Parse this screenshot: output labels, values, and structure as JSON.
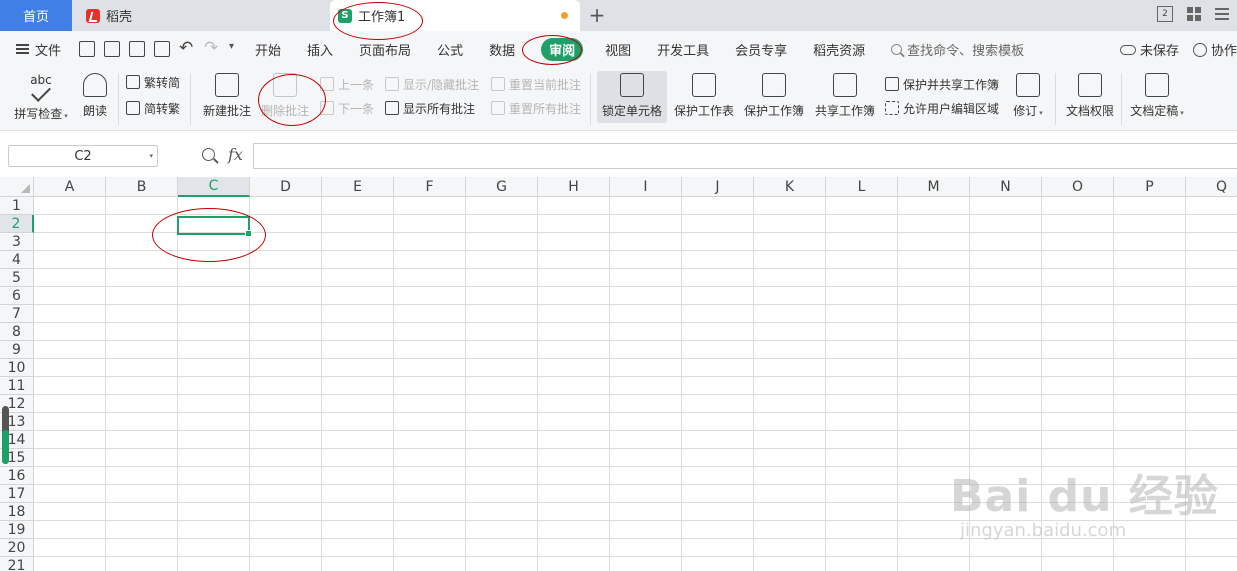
{
  "tabs": {
    "home": "首页",
    "daoke": "稻壳",
    "workbook": "工作簿1",
    "add": "+"
  },
  "window": {
    "layout_badge": "2"
  },
  "menu": {
    "file": "文件",
    "items": [
      "开始",
      "插入",
      "页面布局",
      "公式",
      "数据",
      "审阅",
      "视图",
      "开发工具",
      "会员专享",
      "稻壳资源"
    ],
    "active": "审阅",
    "search": "查找命令、搜索模板",
    "unsaved": "未保存",
    "collab": "协作"
  },
  "ribbon": {
    "abc": "abc",
    "spell_check": "拼写检查",
    "read_aloud": "朗读",
    "trad_to_simp": "繁转简",
    "simp_to_trad": "简转繁",
    "new_comment": "新建批注",
    "delete_comment": "删除批注",
    "prev": "上一条",
    "next": "下一条",
    "show_hide_comment": "显示/隐藏批注",
    "show_all_comments": "显示所有批注",
    "reset_current_comment": "重置当前批注",
    "reset_all_comments": "重置所有批注",
    "lock_cell": "锁定单元格",
    "protect_sheet": "保护工作表",
    "protect_workbook": "保护工作簿",
    "share_workbook": "共享工作簿",
    "protect_share_workbook": "保护并共享工作簿",
    "allow_edit_ranges": "允许用户编辑区域",
    "track_changes": "修订",
    "doc_permission": "文档权限",
    "doc_finalize": "文档定稿"
  },
  "formula_bar": {
    "name_box": "C2",
    "fx": "fx",
    "value": ""
  },
  "sheet": {
    "columns": [
      "A",
      "B",
      "C",
      "D",
      "E",
      "F",
      "G",
      "H",
      "I",
      "J",
      "K",
      "L",
      "M",
      "N",
      "O",
      "P",
      "Q"
    ],
    "rows": [
      "1",
      "2",
      "3",
      "4",
      "5",
      "6",
      "7",
      "8",
      "9",
      "10",
      "11",
      "12",
      "13",
      "14",
      "15",
      "16",
      "17",
      "18",
      "19",
      "20",
      "21"
    ],
    "selected_column": "C",
    "selected_row": "2"
  },
  "colors": {
    "accent_green": "#1da168",
    "home_tab_blue": "#3f7fe6",
    "annotation_red": "#c00000"
  },
  "watermark": {
    "brand": "Bai du 经验",
    "url": "jingyan.baidu.com"
  }
}
